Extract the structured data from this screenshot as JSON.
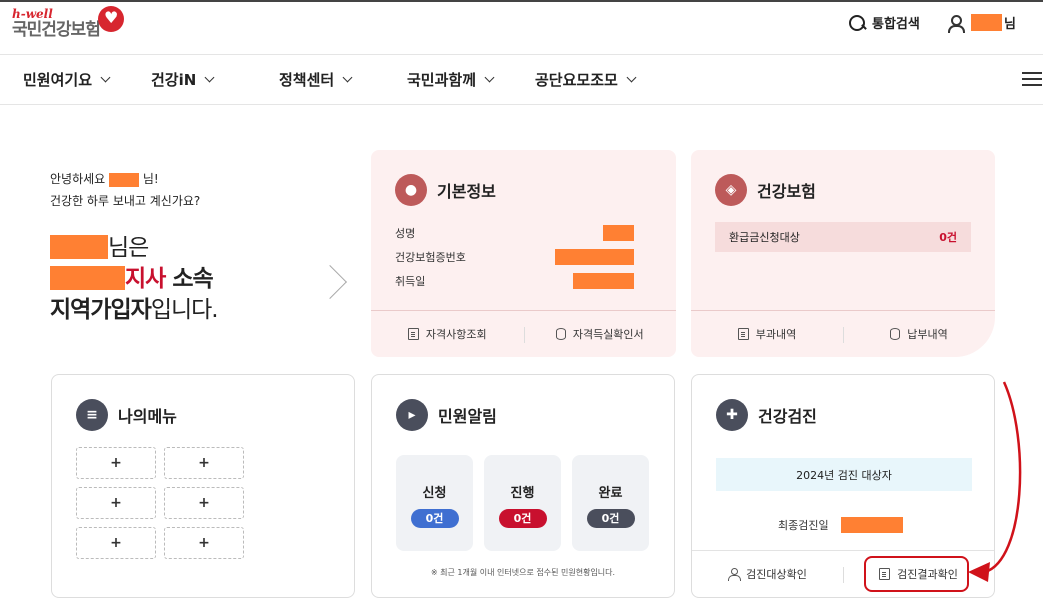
{
  "header": {
    "logo_top": "h-well",
    "logo_main": "국민건강보험",
    "search_label": "통합검색",
    "user_suffix": "님"
  },
  "nav": {
    "items": [
      {
        "label": "민원여기요"
      },
      {
        "label": "건강iN"
      },
      {
        "label": "정책센터"
      },
      {
        "label": "국민과함께"
      },
      {
        "label": "공단요모조모"
      }
    ]
  },
  "greeting": {
    "hello_prefix": "안녕하세요",
    "hello_suffix": "님!",
    "line2": "건강한 하루 보내고 계신가요?",
    "name_suffix": "님은",
    "branch_label": "지사",
    "branch_suffix": " 소속",
    "type_label": "지역가입자",
    "type_suffix": "입니다."
  },
  "basic_info": {
    "title": "기본정보",
    "rows": [
      {
        "label": "성명"
      },
      {
        "label": "건강보험증번호"
      },
      {
        "label": "취득일"
      }
    ],
    "links": [
      "자격사항조회",
      "자격득실확인서"
    ]
  },
  "health_insurance": {
    "title": "건강보험",
    "refund_label": "환급금신청대상",
    "refund_count": "0건",
    "links": [
      "부과내역",
      "납부내역"
    ]
  },
  "my_menu": {
    "title": "나의메뉴",
    "add_label": "+"
  },
  "notices": {
    "title": "민원알림",
    "stats": [
      {
        "label": "신청",
        "count": "0건",
        "color": "#3f6fd1"
      },
      {
        "label": "진행",
        "count": "0건",
        "color": "#c8102e"
      },
      {
        "label": "완료",
        "count": "0건",
        "color": "#4a4e5c"
      }
    ],
    "note": "※ 최근 1개월 이내 인터넷으로 접수된 민원현황입니다."
  },
  "checkup": {
    "title": "건강검진",
    "target_label": "2024년 검진 대상자",
    "last_date_label": "최종검진일",
    "links": [
      "검진대상확인",
      "검진결과확인"
    ]
  },
  "colors": {
    "brand_red": "#c8102e",
    "redaction": "#ff8033",
    "card_pink": "#fdf0f0"
  }
}
